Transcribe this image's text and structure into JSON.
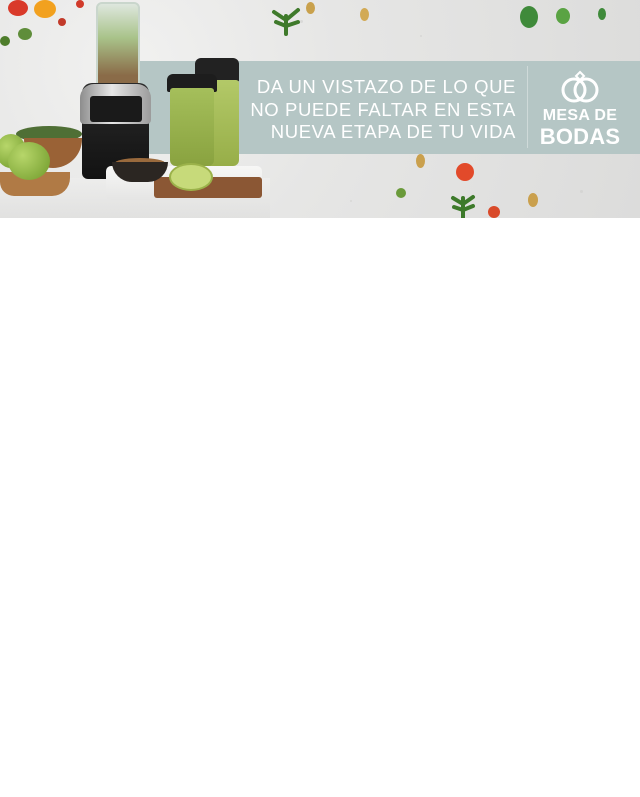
{
  "banner": {
    "headline_lines": [
      "DA UN VISTAZO DE LO QUE",
      "NO PUEDE FALTAR EN ESTA",
      "NUEVA ETAPA DE TU VIDA"
    ],
    "logo": {
      "line1": "MESA DE",
      "line2": "BODAS",
      "icon": "wedding-rings-icon"
    },
    "colors": {
      "ribbon": "#b5c6c5",
      "text": "#ffffff",
      "background": "#e4e4e3",
      "page": "#ffffff"
    }
  }
}
